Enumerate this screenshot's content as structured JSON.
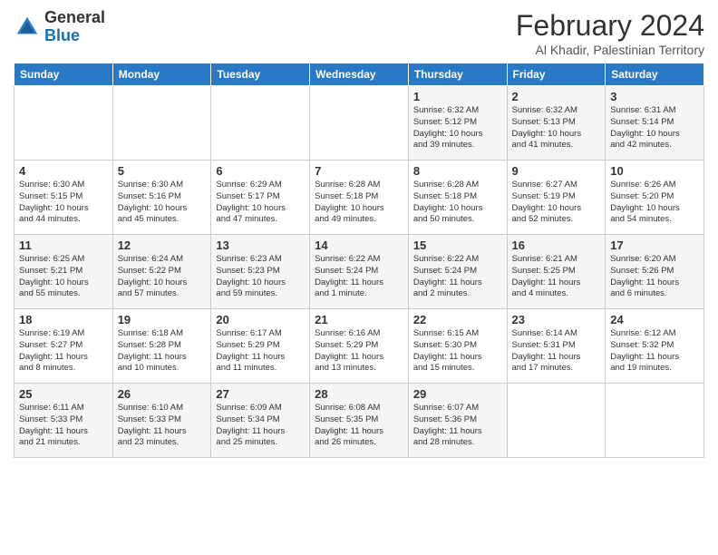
{
  "header": {
    "logo_general": "General",
    "logo_blue": "Blue",
    "month_title": "February 2024",
    "location": "Al Khadir, Palestinian Territory"
  },
  "days_of_week": [
    "Sunday",
    "Monday",
    "Tuesday",
    "Wednesday",
    "Thursday",
    "Friday",
    "Saturday"
  ],
  "weeks": [
    [
      {
        "day": "",
        "info": ""
      },
      {
        "day": "",
        "info": ""
      },
      {
        "day": "",
        "info": ""
      },
      {
        "day": "",
        "info": ""
      },
      {
        "day": "1",
        "info": "Sunrise: 6:32 AM\nSunset: 5:12 PM\nDaylight: 10 hours\nand 39 minutes."
      },
      {
        "day": "2",
        "info": "Sunrise: 6:32 AM\nSunset: 5:13 PM\nDaylight: 10 hours\nand 41 minutes."
      },
      {
        "day": "3",
        "info": "Sunrise: 6:31 AM\nSunset: 5:14 PM\nDaylight: 10 hours\nand 42 minutes."
      }
    ],
    [
      {
        "day": "4",
        "info": "Sunrise: 6:30 AM\nSunset: 5:15 PM\nDaylight: 10 hours\nand 44 minutes."
      },
      {
        "day": "5",
        "info": "Sunrise: 6:30 AM\nSunset: 5:16 PM\nDaylight: 10 hours\nand 45 minutes."
      },
      {
        "day": "6",
        "info": "Sunrise: 6:29 AM\nSunset: 5:17 PM\nDaylight: 10 hours\nand 47 minutes."
      },
      {
        "day": "7",
        "info": "Sunrise: 6:28 AM\nSunset: 5:18 PM\nDaylight: 10 hours\nand 49 minutes."
      },
      {
        "day": "8",
        "info": "Sunrise: 6:28 AM\nSunset: 5:18 PM\nDaylight: 10 hours\nand 50 minutes."
      },
      {
        "day": "9",
        "info": "Sunrise: 6:27 AM\nSunset: 5:19 PM\nDaylight: 10 hours\nand 52 minutes."
      },
      {
        "day": "10",
        "info": "Sunrise: 6:26 AM\nSunset: 5:20 PM\nDaylight: 10 hours\nand 54 minutes."
      }
    ],
    [
      {
        "day": "11",
        "info": "Sunrise: 6:25 AM\nSunset: 5:21 PM\nDaylight: 10 hours\nand 55 minutes."
      },
      {
        "day": "12",
        "info": "Sunrise: 6:24 AM\nSunset: 5:22 PM\nDaylight: 10 hours\nand 57 minutes."
      },
      {
        "day": "13",
        "info": "Sunrise: 6:23 AM\nSunset: 5:23 PM\nDaylight: 10 hours\nand 59 minutes."
      },
      {
        "day": "14",
        "info": "Sunrise: 6:22 AM\nSunset: 5:24 PM\nDaylight: 11 hours\nand 1 minute."
      },
      {
        "day": "15",
        "info": "Sunrise: 6:22 AM\nSunset: 5:24 PM\nDaylight: 11 hours\nand 2 minutes."
      },
      {
        "day": "16",
        "info": "Sunrise: 6:21 AM\nSunset: 5:25 PM\nDaylight: 11 hours\nand 4 minutes."
      },
      {
        "day": "17",
        "info": "Sunrise: 6:20 AM\nSunset: 5:26 PM\nDaylight: 11 hours\nand 6 minutes."
      }
    ],
    [
      {
        "day": "18",
        "info": "Sunrise: 6:19 AM\nSunset: 5:27 PM\nDaylight: 11 hours\nand 8 minutes."
      },
      {
        "day": "19",
        "info": "Sunrise: 6:18 AM\nSunset: 5:28 PM\nDaylight: 11 hours\nand 10 minutes."
      },
      {
        "day": "20",
        "info": "Sunrise: 6:17 AM\nSunset: 5:29 PM\nDaylight: 11 hours\nand 11 minutes."
      },
      {
        "day": "21",
        "info": "Sunrise: 6:16 AM\nSunset: 5:29 PM\nDaylight: 11 hours\nand 13 minutes."
      },
      {
        "day": "22",
        "info": "Sunrise: 6:15 AM\nSunset: 5:30 PM\nDaylight: 11 hours\nand 15 minutes."
      },
      {
        "day": "23",
        "info": "Sunrise: 6:14 AM\nSunset: 5:31 PM\nDaylight: 11 hours\nand 17 minutes."
      },
      {
        "day": "24",
        "info": "Sunrise: 6:12 AM\nSunset: 5:32 PM\nDaylight: 11 hours\nand 19 minutes."
      }
    ],
    [
      {
        "day": "25",
        "info": "Sunrise: 6:11 AM\nSunset: 5:33 PM\nDaylight: 11 hours\nand 21 minutes."
      },
      {
        "day": "26",
        "info": "Sunrise: 6:10 AM\nSunset: 5:33 PM\nDaylight: 11 hours\nand 23 minutes."
      },
      {
        "day": "27",
        "info": "Sunrise: 6:09 AM\nSunset: 5:34 PM\nDaylight: 11 hours\nand 25 minutes."
      },
      {
        "day": "28",
        "info": "Sunrise: 6:08 AM\nSunset: 5:35 PM\nDaylight: 11 hours\nand 26 minutes."
      },
      {
        "day": "29",
        "info": "Sunrise: 6:07 AM\nSunset: 5:36 PM\nDaylight: 11 hours\nand 28 minutes."
      },
      {
        "day": "",
        "info": ""
      },
      {
        "day": "",
        "info": ""
      }
    ]
  ]
}
